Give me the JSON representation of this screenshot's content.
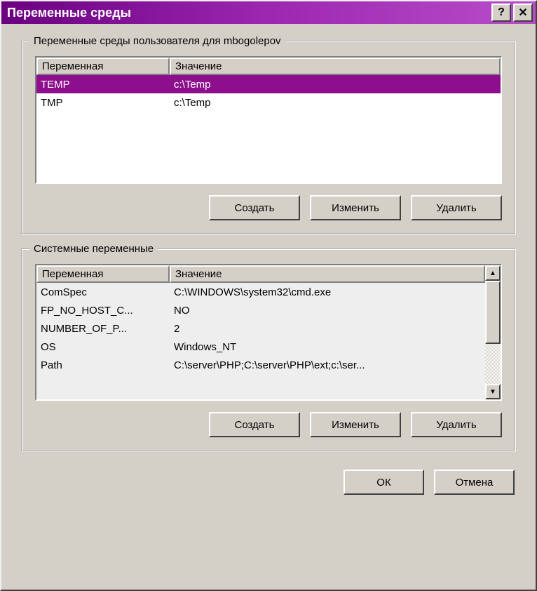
{
  "window": {
    "title": "Переменные среды"
  },
  "user_section": {
    "label": "Переменные среды пользователя для mbogolepov",
    "columns": {
      "name": "Переменная",
      "value": "Значение"
    },
    "rows": [
      {
        "name": "TEMP",
        "value": "c:\\Temp",
        "selected": true
      },
      {
        "name": "TMP",
        "value": "c:\\Temp",
        "selected": false
      }
    ],
    "buttons": {
      "create": "Создать",
      "edit": "Изменить",
      "delete": "Удалить"
    }
  },
  "system_section": {
    "label": "Системные переменные",
    "columns": {
      "name": "Переменная",
      "value": "Значение"
    },
    "rows": [
      {
        "name": "ComSpec",
        "value": "C:\\WINDOWS\\system32\\cmd.exe"
      },
      {
        "name": "FP_NO_HOST_C...",
        "value": "NO"
      },
      {
        "name": "NUMBER_OF_P...",
        "value": "2"
      },
      {
        "name": "OS",
        "value": "Windows_NT"
      },
      {
        "name": "Path",
        "value": "C:\\server\\PHP;C:\\server\\PHP\\ext;c:\\ser..."
      }
    ],
    "buttons": {
      "create": "Создать",
      "edit": "Изменить",
      "delete": "Удалить"
    }
  },
  "dialog_buttons": {
    "ok": "ОК",
    "cancel": "Отмена"
  }
}
